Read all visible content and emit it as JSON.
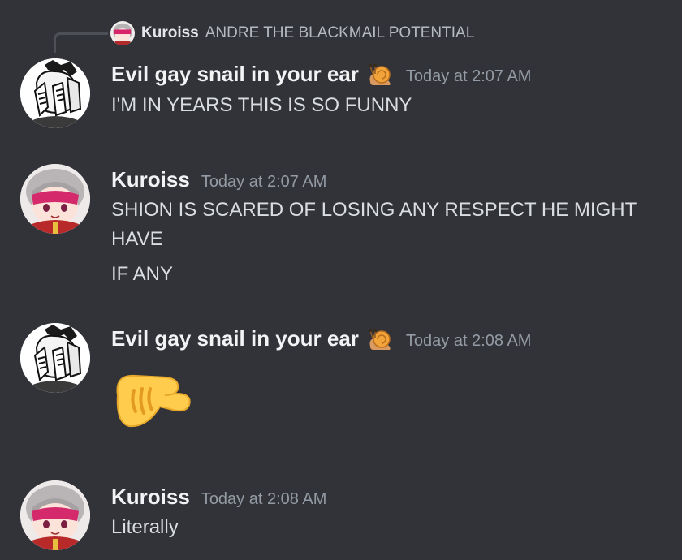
{
  "reply": {
    "author": "Kuroiss",
    "text": "ANDRE THE BLACKMAIL POTENTIAL"
  },
  "messages": [
    {
      "author": "Evil gay snail in your ear",
      "author_badge_icon": "snail-emoji-icon",
      "timestamp": "Today at 2:07 AM",
      "lines": [
        "I'M IN YEARS THIS IS SO FUNNY"
      ]
    },
    {
      "author": "Kuroiss",
      "timestamp": "Today at 2:07 AM",
      "lines": [
        "SHION IS SCARED OF LOSING ANY RESPECT HE MIGHT",
        "HAVE",
        "IF ANY"
      ]
    },
    {
      "author": "Evil gay snail in your ear",
      "author_badge_icon": "snail-emoji-icon",
      "timestamp": "Today at 2:08 AM",
      "emoji": "pinching-hand-icon"
    },
    {
      "author": "Kuroiss",
      "timestamp": "Today at 2:08 AM",
      "lines": [
        "Literally"
      ]
    }
  ],
  "colors": {
    "background": "#313338",
    "author": "#f2f3f5",
    "timestamp": "#949ba4",
    "text": "#dbdee1"
  }
}
